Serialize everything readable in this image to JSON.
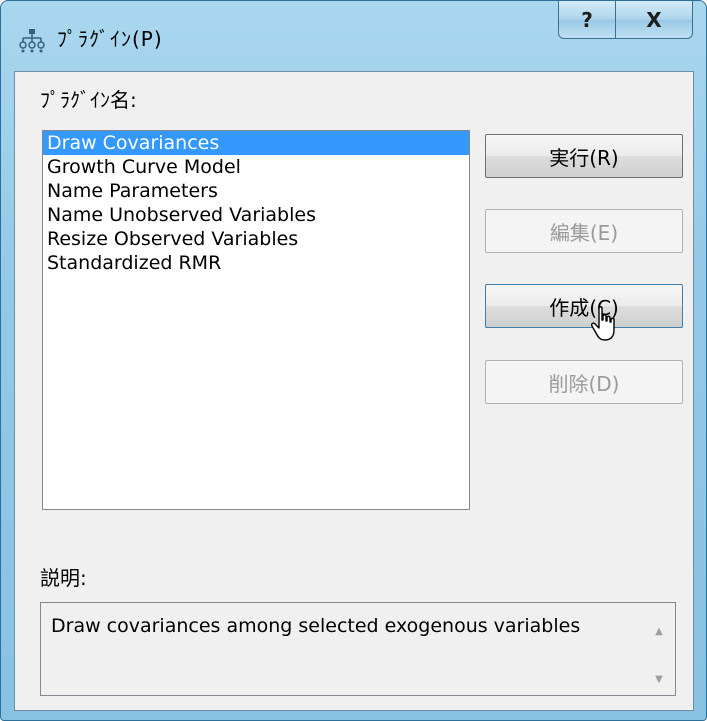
{
  "window": {
    "title": "ﾌﾟﾗｸﾞｲﾝ(P)",
    "help_glyph": "?",
    "close_glyph": "X"
  },
  "plugin_list": {
    "label": "ﾌﾟﾗｸﾞｲﾝ名:",
    "items": [
      "Draw Covariances",
      "Growth Curve Model",
      "Name Parameters",
      "Name Unobserved Variables",
      "Resize Observed Variables",
      "Standardized RMR"
    ],
    "selected_index": 0
  },
  "buttons": {
    "run": "実行(R)",
    "edit": "編集(E)",
    "create": "作成(C)",
    "delete": "削除(D)"
  },
  "description": {
    "label": "説明:",
    "text": "Draw covariances among selected exogenous variables"
  },
  "icons": {
    "app": "plugin-tree-icon",
    "help": "help-icon",
    "close": "close-icon",
    "scroll_up": "scroll-up-arrow-icon",
    "scroll_down": "scroll-down-arrow-icon",
    "cursor": "mouse-pointer-icon"
  },
  "colors": {
    "selection": "#3399ff",
    "titlebar": "#92c9e6",
    "disabled_text": "#9a9a9a"
  }
}
